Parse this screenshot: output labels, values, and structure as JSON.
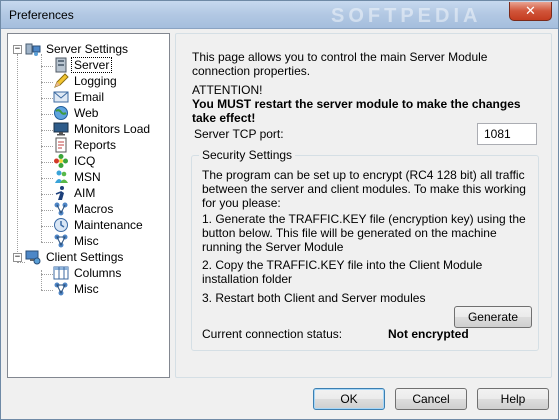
{
  "window": {
    "title": "Preferences",
    "watermark": "SOFTPEDIA",
    "close_glyph": "✕"
  },
  "tree": {
    "items": [
      {
        "label": "Server Settings",
        "icon": "server-settings-icon"
      },
      {
        "label": "Server",
        "icon": "server-icon"
      },
      {
        "label": "Logging",
        "icon": "pencil-icon"
      },
      {
        "label": "Email",
        "icon": "envelope-icon"
      },
      {
        "label": "Web",
        "icon": "globe-icon"
      },
      {
        "label": "Monitors Load",
        "icon": "monitor-icon"
      },
      {
        "label": "Reports",
        "icon": "report-icon"
      },
      {
        "label": "ICQ",
        "icon": "icq-flower-icon"
      },
      {
        "label": "MSN",
        "icon": "msn-icon"
      },
      {
        "label": "AIM",
        "icon": "aim-icon"
      },
      {
        "label": "Macros",
        "icon": "macros-icon"
      },
      {
        "label": "Maintenance",
        "icon": "maintenance-icon"
      },
      {
        "label": "Misc",
        "icon": "misc-icon"
      },
      {
        "label": "Client Settings",
        "icon": "client-settings-icon"
      },
      {
        "label": "Columns",
        "icon": "columns-icon"
      },
      {
        "label": "Misc",
        "icon": "misc-icon"
      }
    ],
    "expander_glyph": "−"
  },
  "content": {
    "intro": "This page allows you to control the main Server Module connection properties.",
    "attention_title": "ATTENTION!",
    "attention_message": "You MUST restart the server module to make the changes take effect!",
    "port_label": "Server TCP port:",
    "port_value": "1081",
    "security": {
      "legend": "Security Settings",
      "description": "The program can be set up to encrypt (RC4 128 bit) all traffic between the server and client modules. To make this working for you please:",
      "step1": "1. Generate the TRAFFIC.KEY file (encryption key) using the button below. This file will be generated on the machine running the Server Module",
      "step2": "2. Copy the TRAFFIC.KEY file into the Client Module installation folder",
      "step3": "3. Restart both Client and Server modules",
      "generate_label": "Generate",
      "status_label": "Current connection status:",
      "status_value": "Not encrypted"
    }
  },
  "buttons": {
    "ok": "OK",
    "cancel": "Cancel",
    "help": "Help"
  },
  "colors": {
    "selection": "#ffffff",
    "titlebar": "#b2c8e3"
  }
}
